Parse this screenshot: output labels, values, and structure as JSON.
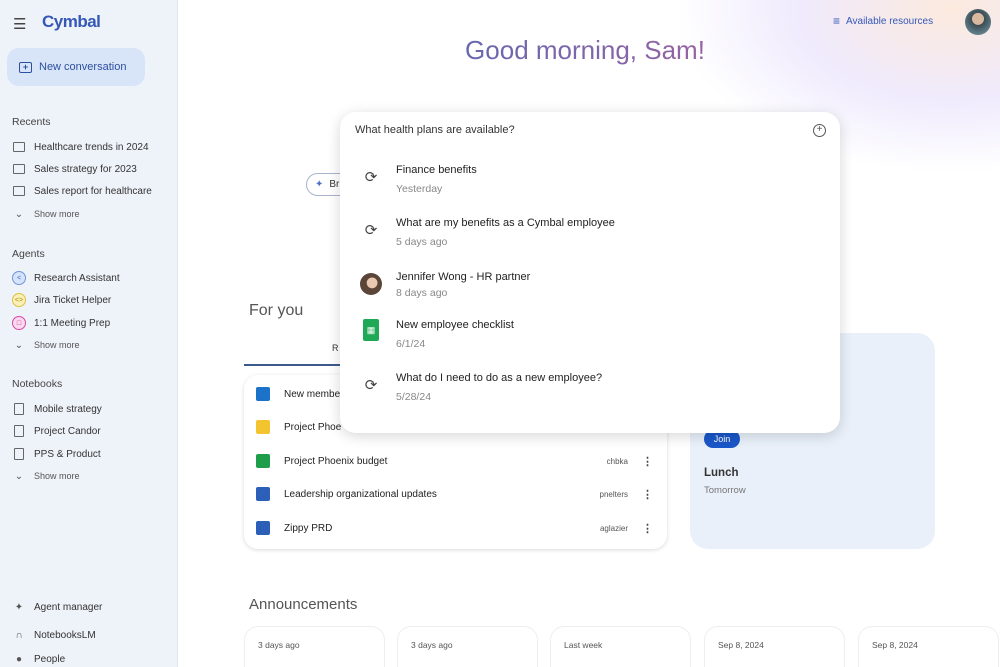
{
  "sidebar": {
    "brand": "Cymbal",
    "new_conversation": "New conversation",
    "recents_heading": "Recents",
    "recents": [
      "Healthcare trends in 2024",
      "Sales strategy for 2023",
      "Sales report for healthcare"
    ],
    "agents_heading": "Agents",
    "agents": [
      "Research Assistant",
      "Jira Ticket Helper",
      "1:1 Meeting Prep"
    ],
    "notebooks_heading": "Notebooks",
    "notebooks": [
      "Mobile strategy",
      "Project Candor",
      "PPS & Product"
    ],
    "show_more": "Show more",
    "bottom": [
      "Agent manager",
      "NotebooksLM",
      "People"
    ]
  },
  "header": {
    "available_resources": "Available resources",
    "greeting": "Good morning, Sam!"
  },
  "search": {
    "query": "What health plans are available?",
    "suggestions": [
      {
        "title": "Finance benefits",
        "sub": "Yesterday",
        "icon": "history-icon"
      },
      {
        "title": "What are my benefits as a Cymbal employee",
        "sub": "5 days ago",
        "icon": "history-icon"
      },
      {
        "title": "Jennifer Wong - HR partner",
        "sub": "8 days ago",
        "icon": "avatar"
      },
      {
        "title": "New employee checklist",
        "sub": "6/1/24",
        "icon": "sheets-icon"
      },
      {
        "title": "What do I need to do as a new employee?",
        "sub": "5/28/24",
        "icon": "history-icon"
      }
    ]
  },
  "chip": "Br",
  "for_you": {
    "heading": "For you",
    "tab": "R",
    "files": [
      {
        "name": "New membe",
        "owner": ""
      },
      {
        "name": "Project Phoe",
        "owner": ""
      },
      {
        "name": "Project Phoenix budget",
        "owner": "chbka"
      },
      {
        "name": "Leadership organizational updates",
        "owner": "pnelters"
      },
      {
        "name": "Zippy PRD",
        "owner": "aglazier"
      }
    ]
  },
  "event": {
    "join": "Join",
    "title": "Lunch",
    "when": "Tomorrow"
  },
  "announcements": {
    "heading": "Announcements",
    "dates": [
      "3 days ago",
      "3 days ago",
      "Last week",
      "Sep 8, 2024",
      "Sep 8, 2024"
    ]
  },
  "colors": {
    "accent": "#0b57d0",
    "sidebar_bg": "#eef2f9"
  }
}
